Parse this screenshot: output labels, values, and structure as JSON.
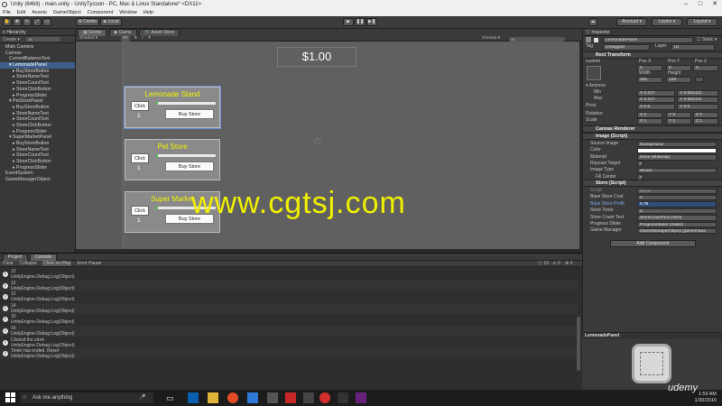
{
  "window": {
    "title": "Unity (64bit) - main.unity - UnityTycoon - PC, Mac & Linux Standalone* <DX11>",
    "menu": [
      "File",
      "Edit",
      "Assets",
      "GameObject",
      "Component",
      "Window",
      "Help"
    ]
  },
  "toolbar": {
    "center": "Center",
    "local": "Local",
    "account": "Account",
    "layers": "Layers",
    "layout": "Layout"
  },
  "hierarchy": {
    "tab": "Hierarchy",
    "create": "Create",
    "search": "All",
    "items": [
      {
        "label": "Main Camera",
        "indent": 1,
        "sel": false
      },
      {
        "label": "Canvas",
        "indent": 1,
        "sel": false
      },
      {
        "label": "CurrentBalanceText",
        "indent": 2,
        "sel": false
      },
      {
        "label": "LemonadePanel",
        "indent": 2,
        "sel": true
      },
      {
        "label": "BuyStoreButton",
        "indent": 3,
        "sel": false
      },
      {
        "label": "StoreNameText",
        "indent": 3,
        "sel": false
      },
      {
        "label": "StoreCountText",
        "indent": 3,
        "sel": false
      },
      {
        "label": "StoreClickButton",
        "indent": 3,
        "sel": false
      },
      {
        "label": "ProgressSlider",
        "indent": 3,
        "sel": false
      },
      {
        "label": "PetStorePanel",
        "indent": 2,
        "sel": false
      },
      {
        "label": "BuyStoreButton",
        "indent": 3,
        "sel": false
      },
      {
        "label": "StoreNameText",
        "indent": 3,
        "sel": false
      },
      {
        "label": "StoreCountText",
        "indent": 3,
        "sel": false
      },
      {
        "label": "StoreClickButton",
        "indent": 3,
        "sel": false
      },
      {
        "label": "ProgressSlider",
        "indent": 3,
        "sel": false
      },
      {
        "label": "SuperMarketPanel",
        "indent": 2,
        "sel": false
      },
      {
        "label": "BuyStoreButton",
        "indent": 3,
        "sel": false
      },
      {
        "label": "StoreNameText",
        "indent": 3,
        "sel": false
      },
      {
        "label": "StoreCountText",
        "indent": 3,
        "sel": false
      },
      {
        "label": "StoreClickButton",
        "indent": 3,
        "sel": false
      },
      {
        "label": "ProgressSlider",
        "indent": 3,
        "sel": false
      },
      {
        "label": "EventSystem",
        "indent": 1,
        "sel": false
      },
      {
        "label": "GameManagerObject",
        "indent": 1,
        "sel": false
      }
    ]
  },
  "scene": {
    "tabs": [
      "Scene",
      "Game",
      "Asset Store"
    ],
    "shaded": "Shaded",
    "mode2d": "2D",
    "gizmos": "Gizmos",
    "search": "All",
    "balance": "$1.00",
    "panels": [
      {
        "title": "Lemonade Stand",
        "click": "Click",
        "count": "1",
        "buy": "Buy Store",
        "progress": 0.03
      },
      {
        "title": "Pet Store",
        "click": "Click",
        "count": "1",
        "buy": "Buy Store",
        "progress": 0.03
      },
      {
        "title": "Super Market",
        "click": "Click",
        "count": "1",
        "buy": "Buy Store",
        "progress": 0.03
      }
    ]
  },
  "watermark": "www.cgtsj.com",
  "inspector": {
    "tab": "Inspector",
    "object": "LemonadePanel",
    "static": "Static",
    "tag_label": "Tag",
    "tag": "Untagged",
    "layer_label": "Layer",
    "layer": "UI",
    "rect": {
      "title": "Rect Transform",
      "anchor": "custom",
      "posx_l": "Pos X",
      "posy_l": "Pos Y",
      "posz_l": "Pos Z",
      "posx": "0",
      "posy": "0",
      "posz": "0",
      "width_l": "Width",
      "height_l": "Height",
      "width": "255",
      "height": "109",
      "anchors": "Anchors",
      "min": "Min",
      "max": "Max",
      "min_x": "X 0.217",
      "min_y": "Y 0.652422",
      "max_x": "X 0.217",
      "max_y": "Y 0.652422",
      "pivot": "Pivot",
      "pivot_x": "X 0.5",
      "pivot_y": "Y 0.5",
      "rotation": "Rotation",
      "rx": "X 0",
      "ry": "Y 0",
      "rz": "Z 0",
      "scale": "Scale",
      "sx": "X 1",
      "sy": "Y 1",
      "sz": "Z 1"
    },
    "canvas_renderer": "Canvas Renderer",
    "image": {
      "title": "Image (Script)",
      "rows": [
        {
          "label": "Source Image",
          "value": "Background"
        },
        {
          "label": "Color",
          "value": ""
        },
        {
          "label": "Material",
          "value": "None (Material)"
        },
        {
          "label": "Raycast Target",
          "value": "✔"
        },
        {
          "label": "Image Type",
          "value": "Sliced"
        },
        {
          "label": "Fill Center",
          "value": "✔"
        }
      ]
    },
    "store": {
      "title": "Store (Script)",
      "rows": [
        {
          "label": "Script",
          "value": "Store"
        },
        {
          "label": "Base Store Cost",
          "value": "2"
        },
        {
          "label": "Base Store Profit",
          "value": "0.75"
        },
        {
          "label": "Store Timer",
          "value": "3"
        },
        {
          "label": "Store Count Text",
          "value": "StoreCountText (Text)"
        },
        {
          "label": "Progress Slider",
          "value": "ProgressSlider (Slider)"
        },
        {
          "label": "Game Manager",
          "value": "GameManagerObject (gamemana"
        }
      ]
    },
    "add_component": "Add Component",
    "preview_title": "LemonadePanel"
  },
  "console": {
    "tabs": [
      "Project",
      "Console"
    ],
    "buttons": [
      "Clear",
      "Collapse",
      "Clear on Play",
      "Error Pause"
    ],
    "counts": [
      "19",
      "0",
      "0"
    ],
    "logs": [
      {
        "l1": "12",
        "l2": "UnityEngine.Debug:Log(Object)"
      },
      {
        "l1": "12",
        "l2": "UnityEngine.Debug:Log(Object)"
      },
      {
        "l1": "12",
        "l2": "UnityEngine.Debug:Log(Object)"
      },
      {
        "l1": "14",
        "l2": "UnityEngine.Debug:Log(Object)"
      },
      {
        "l1": "15",
        "l2": "UnityEngine.Debug:Log(Object)"
      },
      {
        "l1": "16",
        "l2": "UnityEngine.Debug:Log(Object)"
      },
      {
        "l1": "Clicked the store",
        "l2": "UnityEngine.Debug:Log(Object)"
      },
      {
        "l1": "Timer has ended. Reset",
        "l2": "UnityEngine.Debug:Log(Object)"
      }
    ]
  },
  "taskbar": {
    "search": "Ask me anything",
    "time": "1:59 AM",
    "date": "1/30/2016",
    "brand": "udemy"
  },
  "colors": {
    "accent": "#3d5f8a",
    "yellow": "#f2f200",
    "green": "#3ac13a"
  }
}
